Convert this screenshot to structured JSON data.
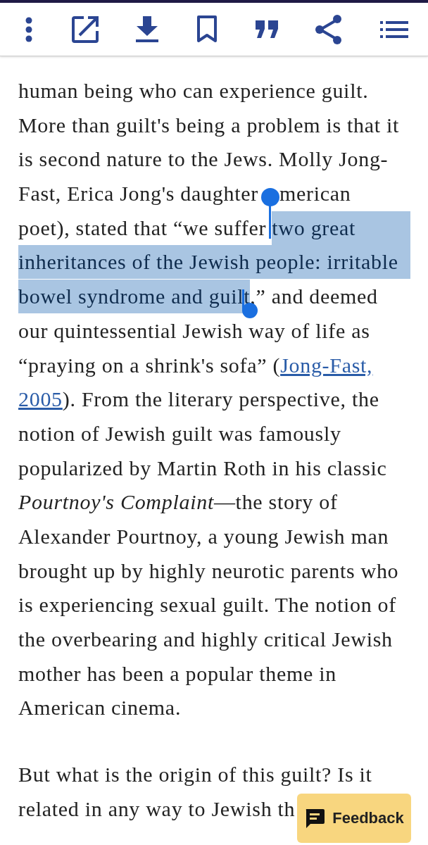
{
  "article": {
    "paragraphs": [
      {
        "lines": [
          [
            {
              "text": "human being who can experience guilt.",
              "kind": "plain",
              "selected": false
            }
          ],
          [
            {
              "text": "More than guilt's being a problem is that it",
              "kind": "plain",
              "selected": false
            }
          ],
          [
            {
              "text": "is second nature to the Jews. Molly Jong-",
              "kind": "plain",
              "selected": false
            }
          ],
          [
            {
              "text": "Fast, Erica Jong's daughter",
              "kind": "plain",
              "selected": false
            },
            {
              "kind": "selection_handle"
            },
            {
              "text": "merican",
              "kind": "plain",
              "selected": false
            }
          ],
          [
            {
              "text": "poet), stated that “we suffer ",
              "kind": "plain",
              "selected": false
            },
            {
              "text": "two great",
              "kind": "plain",
              "selected": true
            }
          ],
          [
            {
              "text": "inheritances of the Jewish people: irritable",
              "kind": "plain",
              "selected": true
            }
          ],
          [
            {
              "text": "bowel syndrome and guilt",
              "kind": "plain",
              "selected": true
            },
            {
              "text": ",” and deemed",
              "kind": "plain",
              "selected": false
            }
          ],
          [
            {
              "text": "our quintessential Jewish way of life as",
              "kind": "plain",
              "selected": false
            }
          ],
          [
            {
              "text": "“praying on a shrink's sofa” (",
              "kind": "plain",
              "selected": false
            },
            {
              "text": "Jong-Fast,",
              "kind": "link",
              "selected": false
            }
          ],
          [
            {
              "text": "2005",
              "kind": "link",
              "selected": false
            },
            {
              "text": "). From the literary perspective, the",
              "kind": "plain",
              "selected": false
            }
          ],
          [
            {
              "text": "notion of Jewish guilt was famously",
              "kind": "plain",
              "selected": false
            }
          ],
          [
            {
              "text": "popularized by Martin Roth in his classic",
              "kind": "plain",
              "selected": false
            }
          ],
          [
            {
              "text": "Pourtnoy's Complaint",
              "kind": "italic",
              "selected": false
            },
            {
              "text": "—the story of",
              "kind": "plain",
              "selected": false
            }
          ],
          [
            {
              "text": "Alexander Pourtnoy, a young Jewish man",
              "kind": "plain",
              "selected": false
            }
          ],
          [
            {
              "text": "brought up by highly neurotic parents who",
              "kind": "plain",
              "selected": false
            }
          ],
          [
            {
              "text": "is experiencing sexual guilt. The notion of",
              "kind": "plain",
              "selected": false
            }
          ],
          [
            {
              "text": "the overbearing and highly critical Jewish",
              "kind": "plain",
              "selected": false
            }
          ],
          [
            {
              "text": "mother has been a popular theme in",
              "kind": "plain",
              "selected": false
            }
          ],
          [
            {
              "text": "American cinema.",
              "kind": "plain",
              "selected": false
            }
          ]
        ]
      },
      {
        "lines": [
          [
            {
              "text": "But what is the origin of this guilt? Is it",
              "kind": "plain",
              "selected": false
            }
          ],
          [
            {
              "text": "related in any way to Jewish th",
              "kind": "plain",
              "selected": false
            }
          ]
        ]
      }
    ]
  },
  "feedback_button": {
    "label": "Feedback"
  }
}
